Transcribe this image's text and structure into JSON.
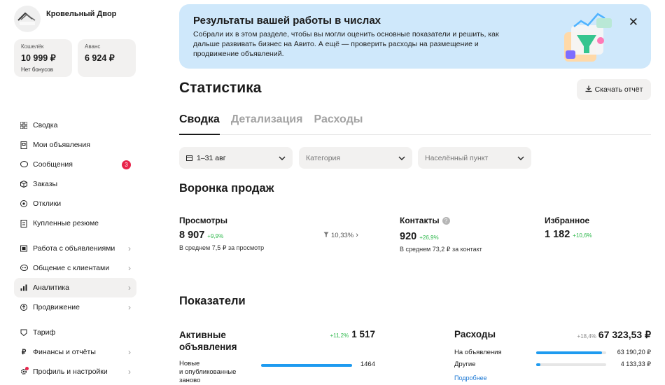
{
  "company": {
    "name": "Кровельный Двор",
    "logo_text": "Кровельный Двор"
  },
  "wallet": {
    "label": "Кошелёк",
    "value": "10 999 ₽",
    "sub": "Нет бонусов"
  },
  "advance": {
    "label": "Аванс",
    "value": "6 924 ₽"
  },
  "nav": {
    "items": [
      {
        "label": "Сводка",
        "icon": "grid-icon"
      },
      {
        "label": "Мои объявления",
        "icon": "document-icon"
      },
      {
        "label": "Сообщения",
        "icon": "chat-icon",
        "badge": "3"
      },
      {
        "label": "Заказы",
        "icon": "box-icon"
      },
      {
        "label": "Отклики",
        "icon": "response-icon"
      },
      {
        "label": "Купленные резюме",
        "icon": "resume-icon"
      },
      {
        "label": "Работа с объявлениями",
        "icon": "ads-work-icon"
      },
      {
        "label": "Общение с клиентами",
        "icon": "clients-icon"
      },
      {
        "label": "Аналитика",
        "icon": "analytics-icon"
      },
      {
        "label": "Продвижение",
        "icon": "promotion-icon"
      },
      {
        "label": "Тариф",
        "icon": "tariff-icon"
      },
      {
        "label": "Финансы и отчёты",
        "icon": "ruble-icon"
      },
      {
        "label": "Профиль и настройки",
        "icon": "gear-icon"
      }
    ]
  },
  "banner": {
    "title": "Результаты вашей работы в числах",
    "text": "Собрали их в этом разделе, чтобы вы могли оценить основные показатели и решить, как дальше развивать бизнес на Авито. А ещё — проверить расходы на размещение и продвижение объявлений."
  },
  "page": {
    "title": "Статистика",
    "download_label": "Скачать отчёт"
  },
  "tabs": [
    {
      "label": "Сводка"
    },
    {
      "label": "Детализация"
    },
    {
      "label": "Расходы"
    }
  ],
  "filters": {
    "period": "1–31 авг",
    "category_placeholder": "Категория",
    "location_placeholder": "Населённый пункт"
  },
  "funnel": {
    "title": "Воронка продаж",
    "views": {
      "label": "Просмотры",
      "value": "8 907",
      "delta": "+9,9%",
      "sub": "В среднем 7,5 ₽ за просмотр"
    },
    "conversion": "10,33%",
    "contacts": {
      "label": "Контакты",
      "value": "920",
      "delta": "+26,9%",
      "sub": "В среднем 73,2 ₽ за контакт"
    },
    "favorites": {
      "label": "Избранное",
      "value": "1 182",
      "delta": "+10,6%"
    }
  },
  "indicators": {
    "title": "Показатели",
    "active": {
      "label_line1": "Активные",
      "label_line2": "объявления",
      "delta": "+11,2%",
      "value": "1 517",
      "rows": [
        {
          "label_lines": [
            "Новые",
            "и опубликованные",
            "заново"
          ],
          "value": "1464",
          "fraction": 1.0
        }
      ]
    },
    "expenses": {
      "label": "Расходы",
      "delta": "+18,4%",
      "value": "67 323,53 ₽",
      "rows": [
        {
          "label": "На объявления",
          "value": "63 190,20 ₽",
          "fraction": 0.94
        },
        {
          "label": "Другие",
          "value": "4 133,33 ₽",
          "fraction": 0.06
        }
      ],
      "more_link": "Подробнее"
    }
  }
}
